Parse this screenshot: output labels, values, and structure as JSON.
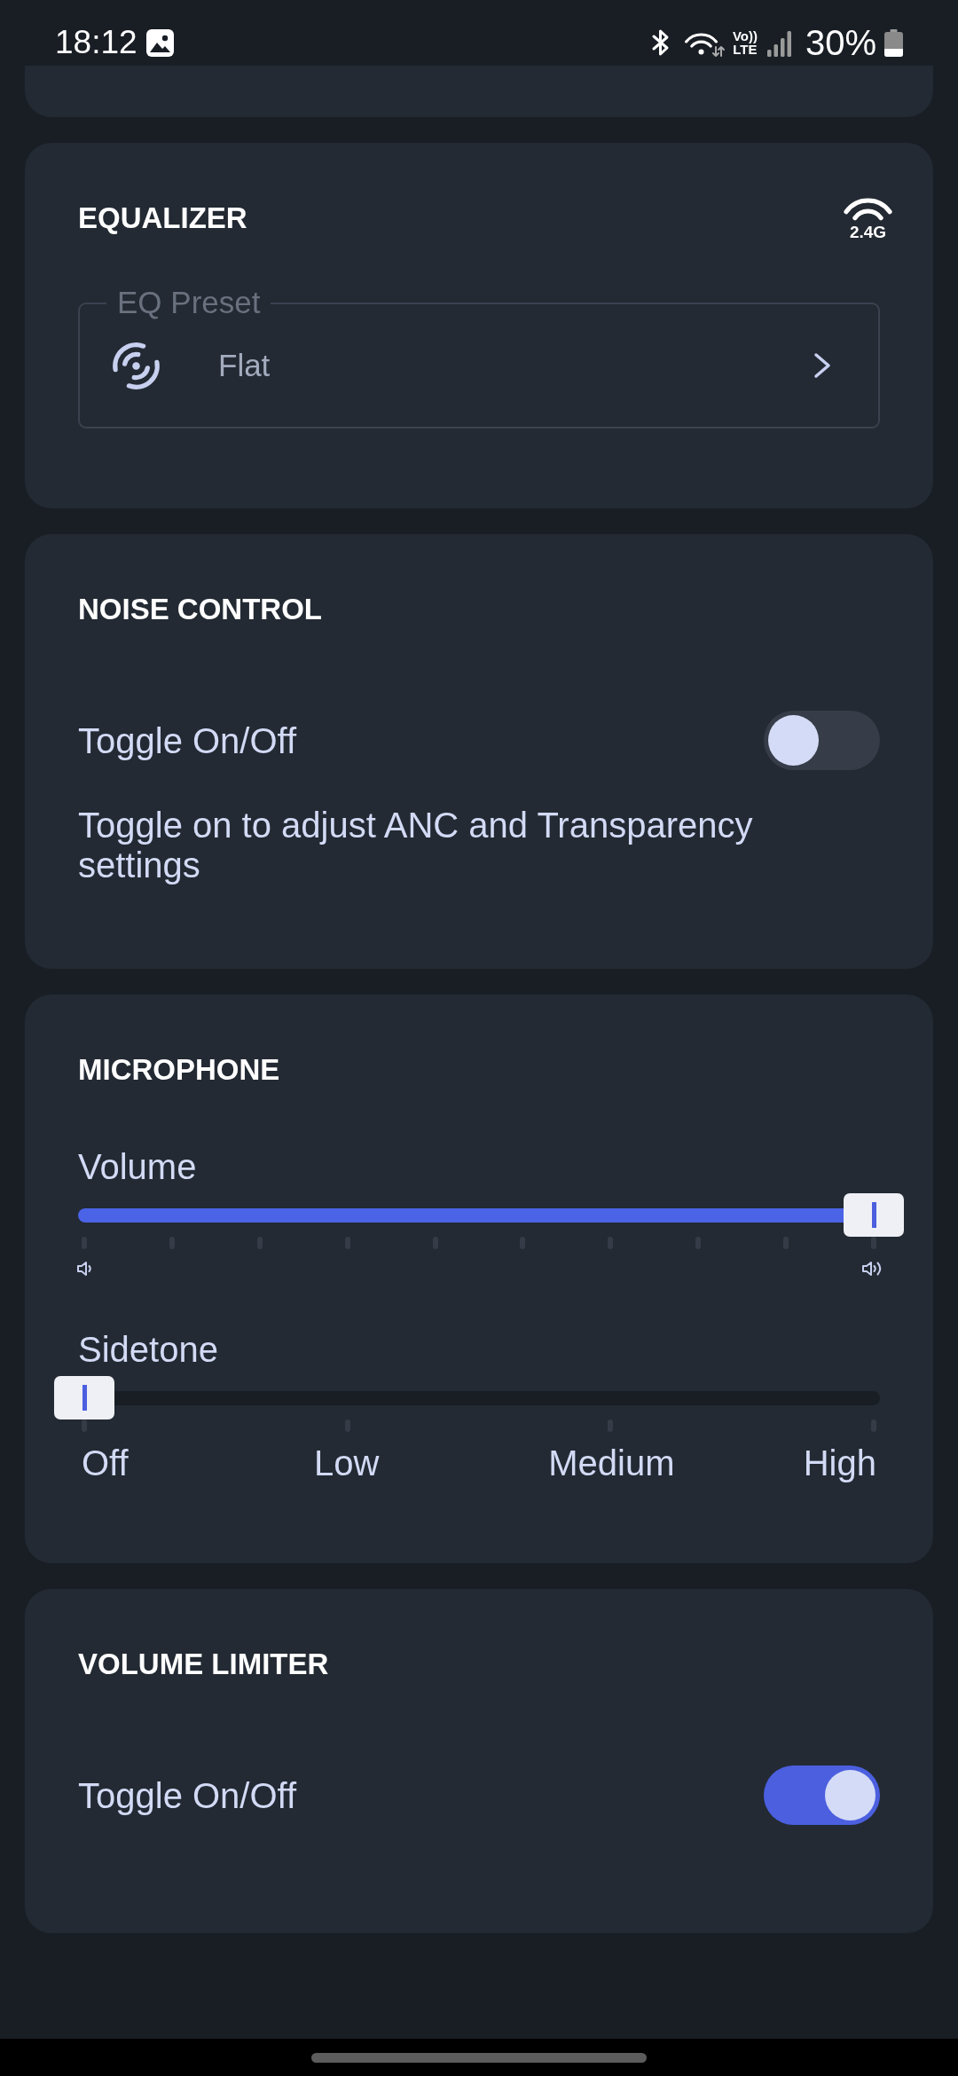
{
  "status_bar": {
    "time": "18:12",
    "network": "Vo)) LTE",
    "battery": "30%"
  },
  "sections": [
    {
      "title": "EQUALIZER",
      "band": "2.4G",
      "rows": [
        {
          "kind": "preset",
          "label": "EQ Preset",
          "value": "Flat"
        }
      ]
    },
    {
      "title": "NOISE CONTROL",
      "rows": [
        {
          "kind": "switch",
          "label": "Toggle On/Off",
          "on": false
        },
        {
          "kind": "note",
          "text": "Toggle on to adjust ANC and Transparency settings"
        }
      ]
    },
    {
      "title": "MICROPHONE",
      "rows": [
        {
          "kind": "volume",
          "label": "Volume",
          "level": 1
        },
        {
          "kind": "steps",
          "label": "Sidetone",
          "level": 0,
          "steps": [
            "Off",
            "Low",
            "Medium",
            "High"
          ]
        }
      ]
    },
    {
      "title": "VOLUME LIMITER",
      "rows": [
        {
          "kind": "switch",
          "label": "Toggle On/Off",
          "on": true
        }
      ]
    }
  ]
}
